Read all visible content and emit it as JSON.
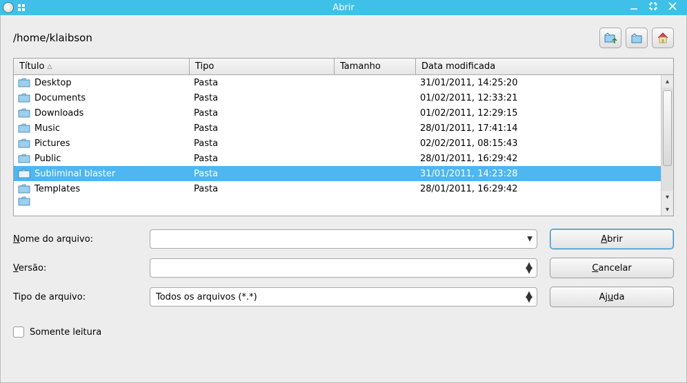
{
  "window": {
    "title": "Abrir"
  },
  "path": "/home/klaibson",
  "columns": {
    "title": "Título",
    "type": "Tipo",
    "size": "Tamanho",
    "modified": "Data modificada"
  },
  "files": [
    {
      "name": "Desktop",
      "type": "Pasta",
      "size": "",
      "modified": "31/01/2011, 14:25:20",
      "selected": false
    },
    {
      "name": "Documents",
      "type": "Pasta",
      "size": "",
      "modified": "01/02/2011, 12:33:21",
      "selected": false
    },
    {
      "name": "Downloads",
      "type": "Pasta",
      "size": "",
      "modified": "01/02/2011, 12:29:15",
      "selected": false
    },
    {
      "name": "Music",
      "type": "Pasta",
      "size": "",
      "modified": "28/01/2011, 17:41:14",
      "selected": false
    },
    {
      "name": "Pictures",
      "type": "Pasta",
      "size": "",
      "modified": "02/02/2011, 08:15:43",
      "selected": false
    },
    {
      "name": "Public",
      "type": "Pasta",
      "size": "",
      "modified": "28/01/2011, 16:29:42",
      "selected": false
    },
    {
      "name": "Subliminal blaster",
      "type": "Pasta",
      "size": "",
      "modified": "31/01/2011, 14:23:28",
      "selected": true
    },
    {
      "name": "Templates",
      "type": "Pasta",
      "size": "",
      "modified": "28/01/2011, 16:29:42",
      "selected": false
    }
  ],
  "labels": {
    "filename": "Nome do arquivo:",
    "filename_ul": "N",
    "version": "Versão:",
    "version_ul": "V",
    "filetype": "Tipo de arquivo:",
    "readonly": "Somente leitura"
  },
  "filetype_value": "Todos os arquivos (*.*)",
  "filename_value": "",
  "version_value": "",
  "buttons": {
    "open": "Abrir",
    "open_ul": "A",
    "cancel": "Cancelar",
    "cancel_ul": "C",
    "help": "Ajuda",
    "help_ul": "u"
  }
}
